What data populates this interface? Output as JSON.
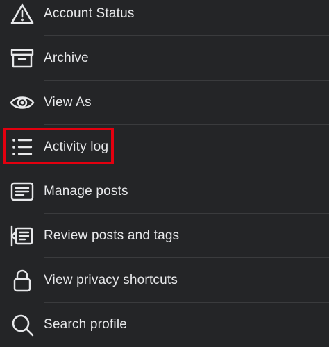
{
  "menu": {
    "items": [
      {
        "label": "Account Status",
        "icon": "warning-triangle-icon"
      },
      {
        "label": "Archive",
        "icon": "archive-box-icon"
      },
      {
        "label": "View As",
        "icon": "eye-icon"
      },
      {
        "label": "Activity log",
        "icon": "list-icon"
      },
      {
        "label": "Manage posts",
        "icon": "posts-card-icon"
      },
      {
        "label": "Review posts and tags",
        "icon": "review-tags-icon"
      },
      {
        "label": "View privacy shortcuts",
        "icon": "lock-icon"
      },
      {
        "label": "Search profile",
        "icon": "search-icon"
      }
    ]
  },
  "colors": {
    "background": "#242527",
    "text": "#e8e9eb",
    "divider": "#3a3b3d",
    "highlight": "#e3000f"
  }
}
